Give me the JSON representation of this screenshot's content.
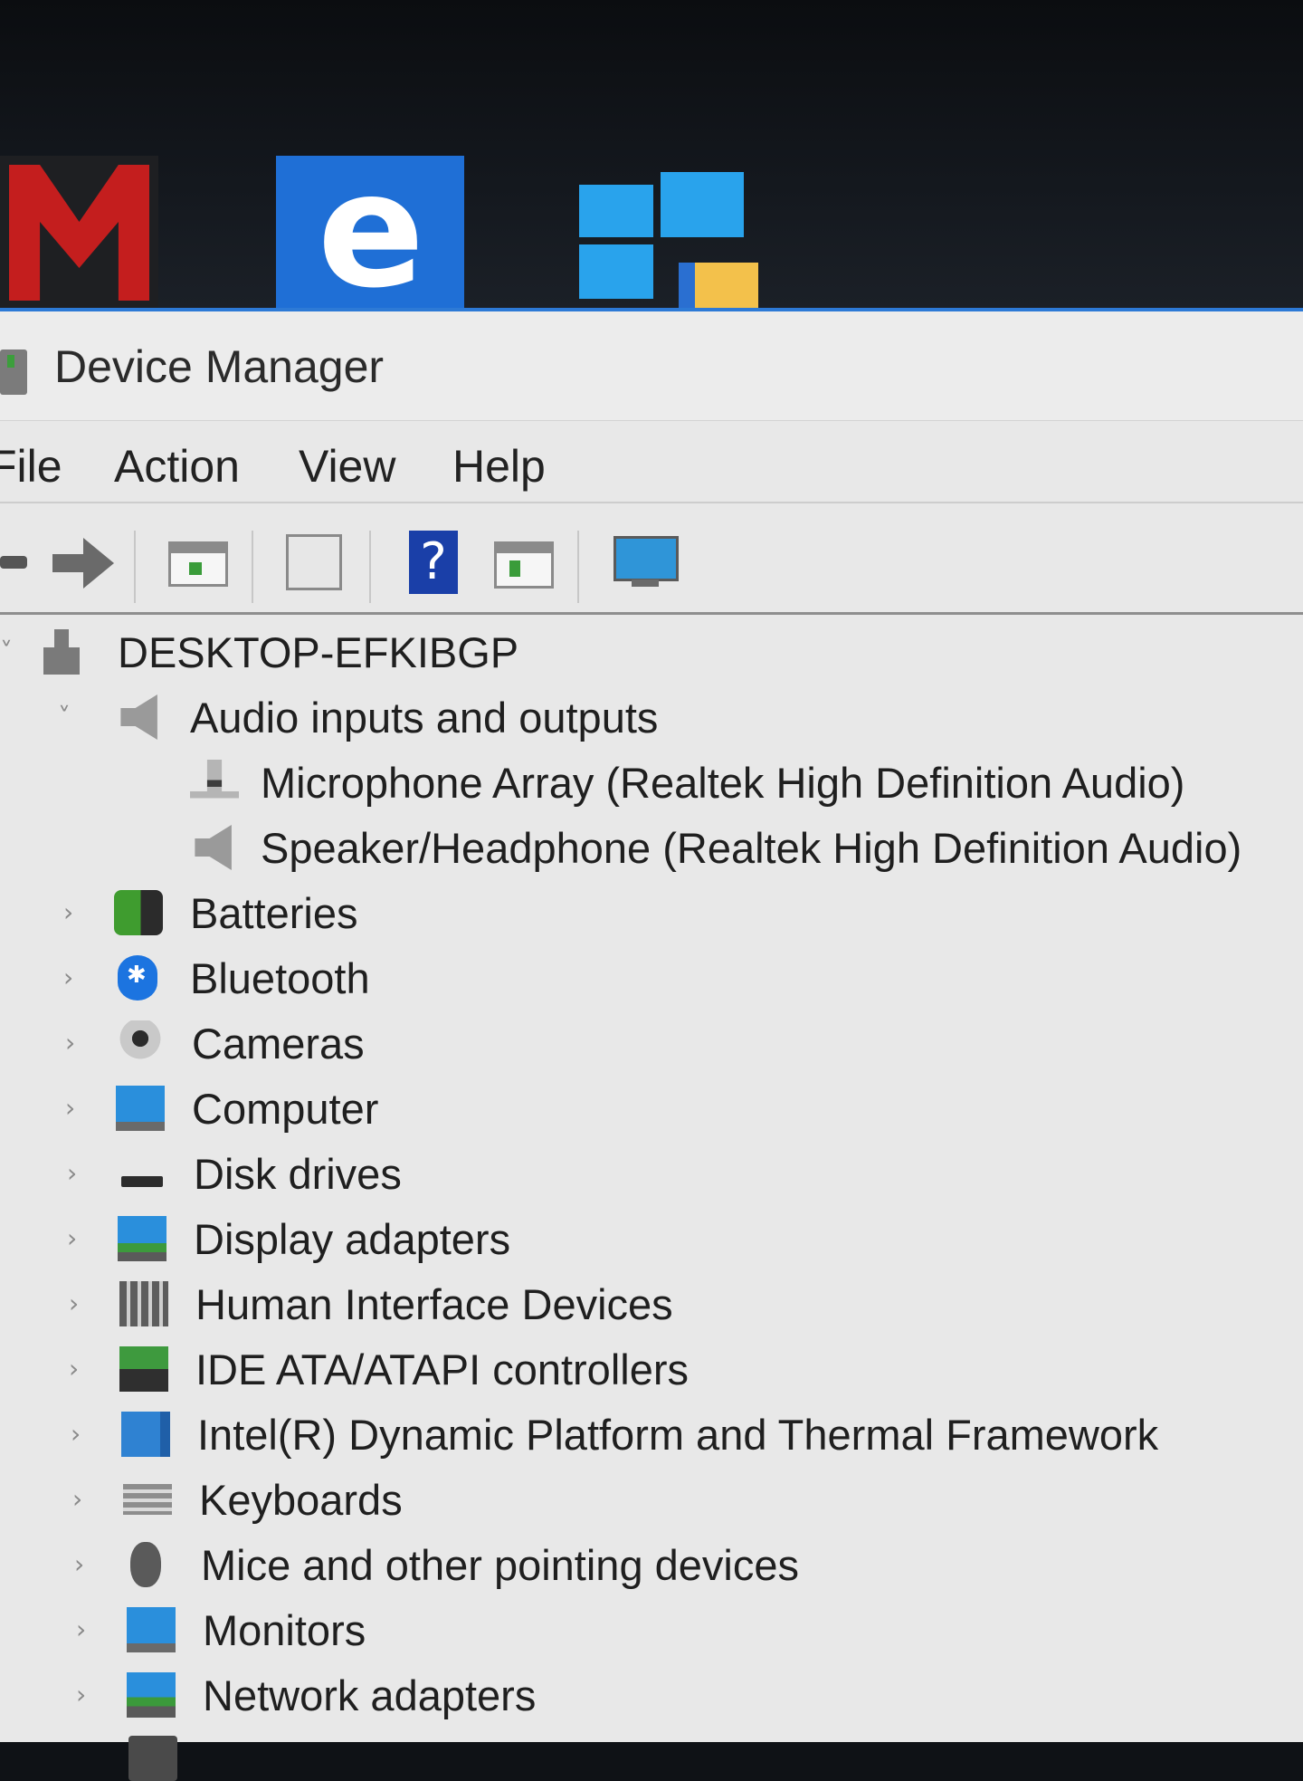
{
  "window": {
    "title": "Device Manager"
  },
  "menubar": {
    "items": [
      "File",
      "Action",
      "View",
      "Help"
    ]
  },
  "toolbar": {
    "buttons": [
      {
        "icon": "back-arrow-icon"
      },
      {
        "icon": "forward-arrow-icon"
      },
      {
        "icon": "show-hide-console-tree-icon"
      },
      {
        "icon": "properties-icon"
      },
      {
        "icon": "help-icon",
        "glyph": "?"
      },
      {
        "icon": "action-pane-icon"
      },
      {
        "icon": "scan-hardware-changes-icon"
      }
    ]
  },
  "tree": {
    "root": {
      "label": "DESKTOP-EFKIBGP",
      "expander": "˅"
    },
    "categories": [
      {
        "label": "Audio inputs and outputs",
        "expander": "˅",
        "icon": "speaker-icon",
        "children": [
          {
            "label": "Microphone Array (Realtek High Definition Audio)",
            "icon": "microphone-icon"
          },
          {
            "label": "Speaker/Headphone (Realtek High Definition Audio)",
            "icon": "speaker-icon"
          }
        ]
      },
      {
        "label": "Batteries",
        "expander": "›",
        "icon": "battery-icon"
      },
      {
        "label": "Bluetooth",
        "expander": "›",
        "icon": "bluetooth-icon"
      },
      {
        "label": "Cameras",
        "expander": "›",
        "icon": "camera-icon"
      },
      {
        "label": "Computer",
        "expander": "›",
        "icon": "computer-icon"
      },
      {
        "label": "Disk drives",
        "expander": "›",
        "icon": "disk-drive-icon"
      },
      {
        "label": "Display adapters",
        "expander": "›",
        "icon": "display-adapter-icon"
      },
      {
        "label": "Human Interface Devices",
        "expander": "›",
        "icon": "hid-icon"
      },
      {
        "label": "IDE ATA/ATAPI controllers",
        "expander": "›",
        "icon": "ide-controller-icon"
      },
      {
        "label": "Intel(R) Dynamic Platform and Thermal Framework",
        "expander": "›",
        "icon": "intel-framework-icon"
      },
      {
        "label": "Keyboards",
        "expander": "›",
        "icon": "keyboard-icon"
      },
      {
        "label": "Mice and other pointing devices",
        "expander": "›",
        "icon": "mouse-icon"
      },
      {
        "label": "Monitors",
        "expander": "›",
        "icon": "monitor-icon"
      },
      {
        "label": "Network adapters",
        "expander": "›",
        "icon": "network-adapter-icon"
      }
    ]
  },
  "taskbar": {
    "tiles": [
      {
        "icon": "mcafee-icon"
      },
      {
        "icon": "edge-icon",
        "glyph": "e"
      },
      {
        "icon": "windows-store-icon"
      }
    ]
  },
  "colors": {
    "window_bg": "#e8e8e8",
    "accent": "#2d7ad6",
    "edge_tile": "#1f6fd6",
    "mcafee": "#c41e1e"
  }
}
